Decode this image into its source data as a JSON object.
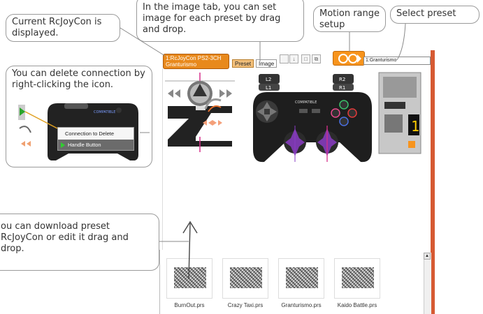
{
  "callouts": {
    "current": "Current RcJoyCon is displayed.",
    "image_tab": "In the image tab, you can set image for each preset by drag and drop.",
    "motion": "Motion range setup",
    "select_preset": "Select preset",
    "delete_connection": "You can delete connection by right-clicking the icon.",
    "download": "ou can download preset RcJoyCon or edit it drag and drop."
  },
  "app": {
    "preset_title_line1": "1:RcJoyCon PS2-3CH",
    "preset_title_line2": "Granturismo",
    "tab_preset": "Preset",
    "tab_image": "Image",
    "select_value": "1:Granturismo",
    "controller_labels": {
      "l2": "L2",
      "l1": "L1",
      "r2": "R2",
      "r1": "R1",
      "compatible": "COMPATIBLE"
    },
    "board_digit": "1"
  },
  "context_menu": {
    "compatible": "COMPATIBLE",
    "item_delete": "Connection to Delete",
    "item_handle": "Handle Button"
  },
  "preset_files": [
    {
      "label": "BurnOut.prs"
    },
    {
      "label": "Crazy Taxi.prs"
    },
    {
      "label": "Granturismo.prs"
    },
    {
      "label": "Kaido Battle.prs"
    }
  ],
  "colors": {
    "accent_orange": "#f7941d",
    "frame_red": "#d65a33",
    "controller_black": "#222222",
    "purple": "#8a3cc4"
  }
}
